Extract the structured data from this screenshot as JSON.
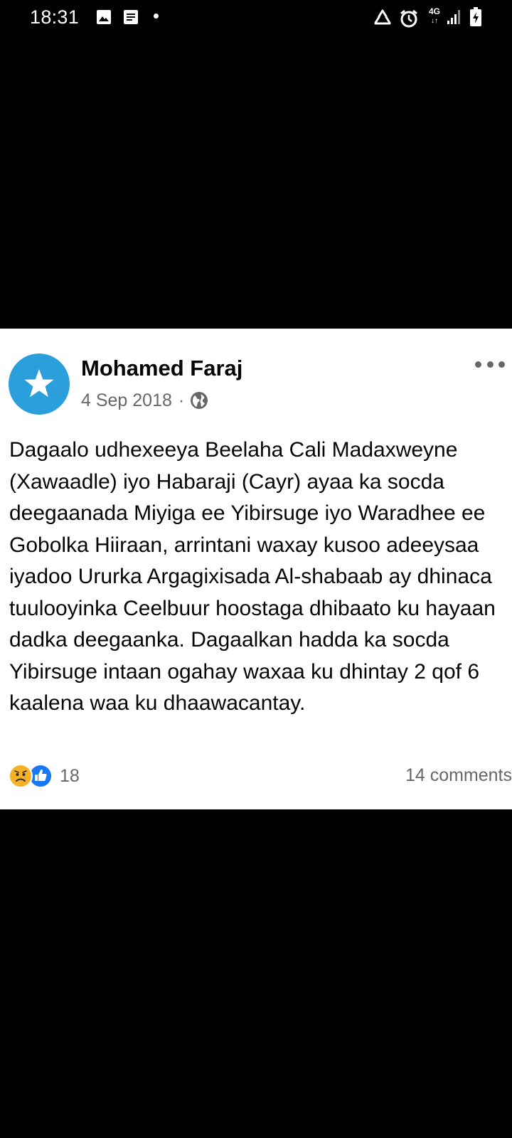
{
  "status_bar": {
    "time": "18:31",
    "network": "4G",
    "icons": [
      "image-icon",
      "note-icon",
      "notification-dot",
      "recycle-icon",
      "alarm-icon",
      "network-4g-icon",
      "signal-icon",
      "battery-icon"
    ]
  },
  "post": {
    "author": "Mohamed Faraj",
    "date": "4 Sep 2018",
    "separator": "·",
    "privacy_icon": "globe-icon",
    "avatar_icon": "star-icon",
    "body": "Dagaalo udhexeeya Beelaha Cali Madaxweyne (Xawaadle) iyo Habaraji (Cayr) ayaa ka socda deegaanada Miyiga ee Yibirsuge iyo Waradhee ee Gobolka Hiiraan, arrintani waxay kusoo adeeysaa iyadoo Ururka Argagixisada Al-shabaab ay dhinaca tuulooyinka Ceelbuur hoostaga dhibaato ku hayaan dadka deegaanka. Dagaalkan hadda ka socda Yibirsuge intaan ogahay waxaa ku dhintay 2 qof 6 kaalena waa ku dhaawacantay.",
    "reactions": {
      "icons": [
        "sad-reaction-icon",
        "like-reaction-icon"
      ],
      "count": "18"
    },
    "comments": "14 comments"
  },
  "colors": {
    "background": "#000000",
    "card": "#ffffff",
    "avatar": "#2b9fdc",
    "text": "#050505",
    "secondary_text": "#65676b",
    "like": "#1877f2",
    "sad": "#f7b125"
  }
}
